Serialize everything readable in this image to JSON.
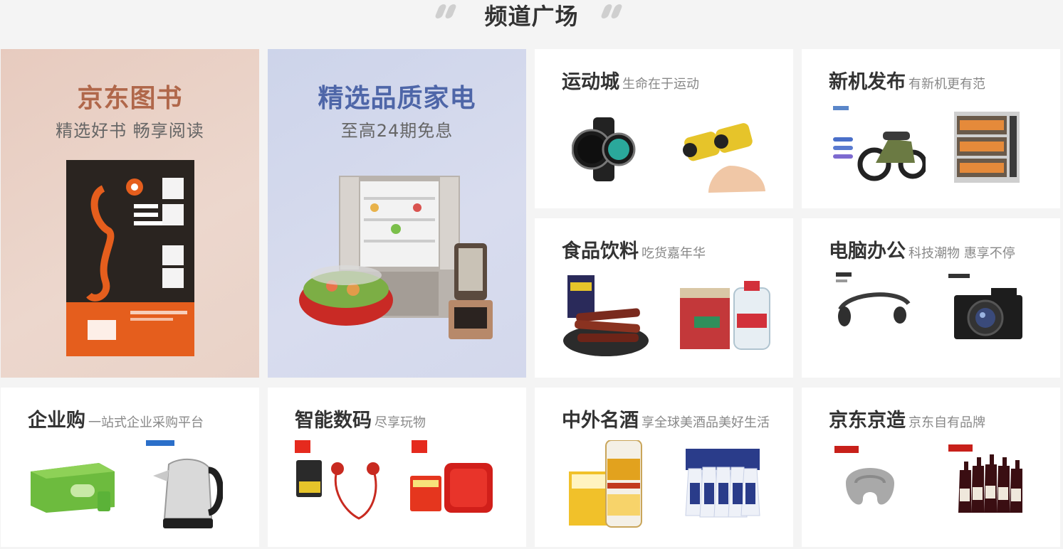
{
  "header": {
    "title": "频道广场"
  },
  "channels": {
    "books": {
      "title": "京东图书",
      "subtitle": "精选好书 畅享阅读"
    },
    "appliance": {
      "title": "精选品质家电",
      "subtitle": "至高24期免息"
    },
    "sports": {
      "name": "运动城",
      "desc": "生命在于运动"
    },
    "newphone": {
      "name": "新机发布",
      "desc": "有新机更有范"
    },
    "food": {
      "name": "食品饮料",
      "desc": "吃货嘉年华"
    },
    "computer": {
      "name": "电脑办公",
      "desc": "科技潮物 惠享不停"
    },
    "enterprise": {
      "name": "企业购",
      "desc": "一站式企业采购平台"
    },
    "digital": {
      "name": "智能数码",
      "desc": "尽享玩物"
    },
    "liquor": {
      "name": "中外名酒",
      "desc": "享全球美酒品美好生活"
    },
    "jdmade": {
      "name": "京东京造",
      "desc": "京东自有品牌"
    }
  },
  "colors": {
    "books_accent": "#b0674a",
    "appliance_accent": "#4e66a8",
    "page_bg": "#f4f4f4"
  }
}
